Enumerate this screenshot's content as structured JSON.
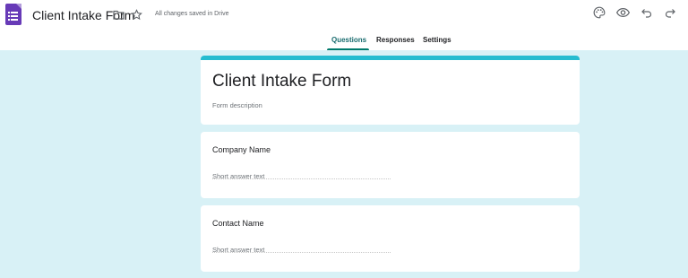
{
  "header": {
    "doc_title": "Client Intake Form",
    "save_status": "All changes saved in Drive",
    "icons": [
      "forms-app-icon",
      "folder-icon",
      "star-icon",
      "palette-icon",
      "preview-eye-icon",
      "undo-icon",
      "redo-icon"
    ]
  },
  "tabs": [
    {
      "label": "Questions",
      "active": true
    },
    {
      "label": "Responses",
      "active": false
    },
    {
      "label": "Settings",
      "active": false
    }
  ],
  "form": {
    "title": "Client Intake Form",
    "description_placeholder": "Form description",
    "questions": [
      {
        "title": "Company Name",
        "answer_placeholder": "Short answer text"
      },
      {
        "title": "Contact Name",
        "answer_placeholder": "Short answer text"
      }
    ]
  },
  "colors": {
    "theme_accent": "#26bcd0",
    "background": "#d8f1f6",
    "app_icon": "#673ab7",
    "active_tab": "#00796b"
  }
}
